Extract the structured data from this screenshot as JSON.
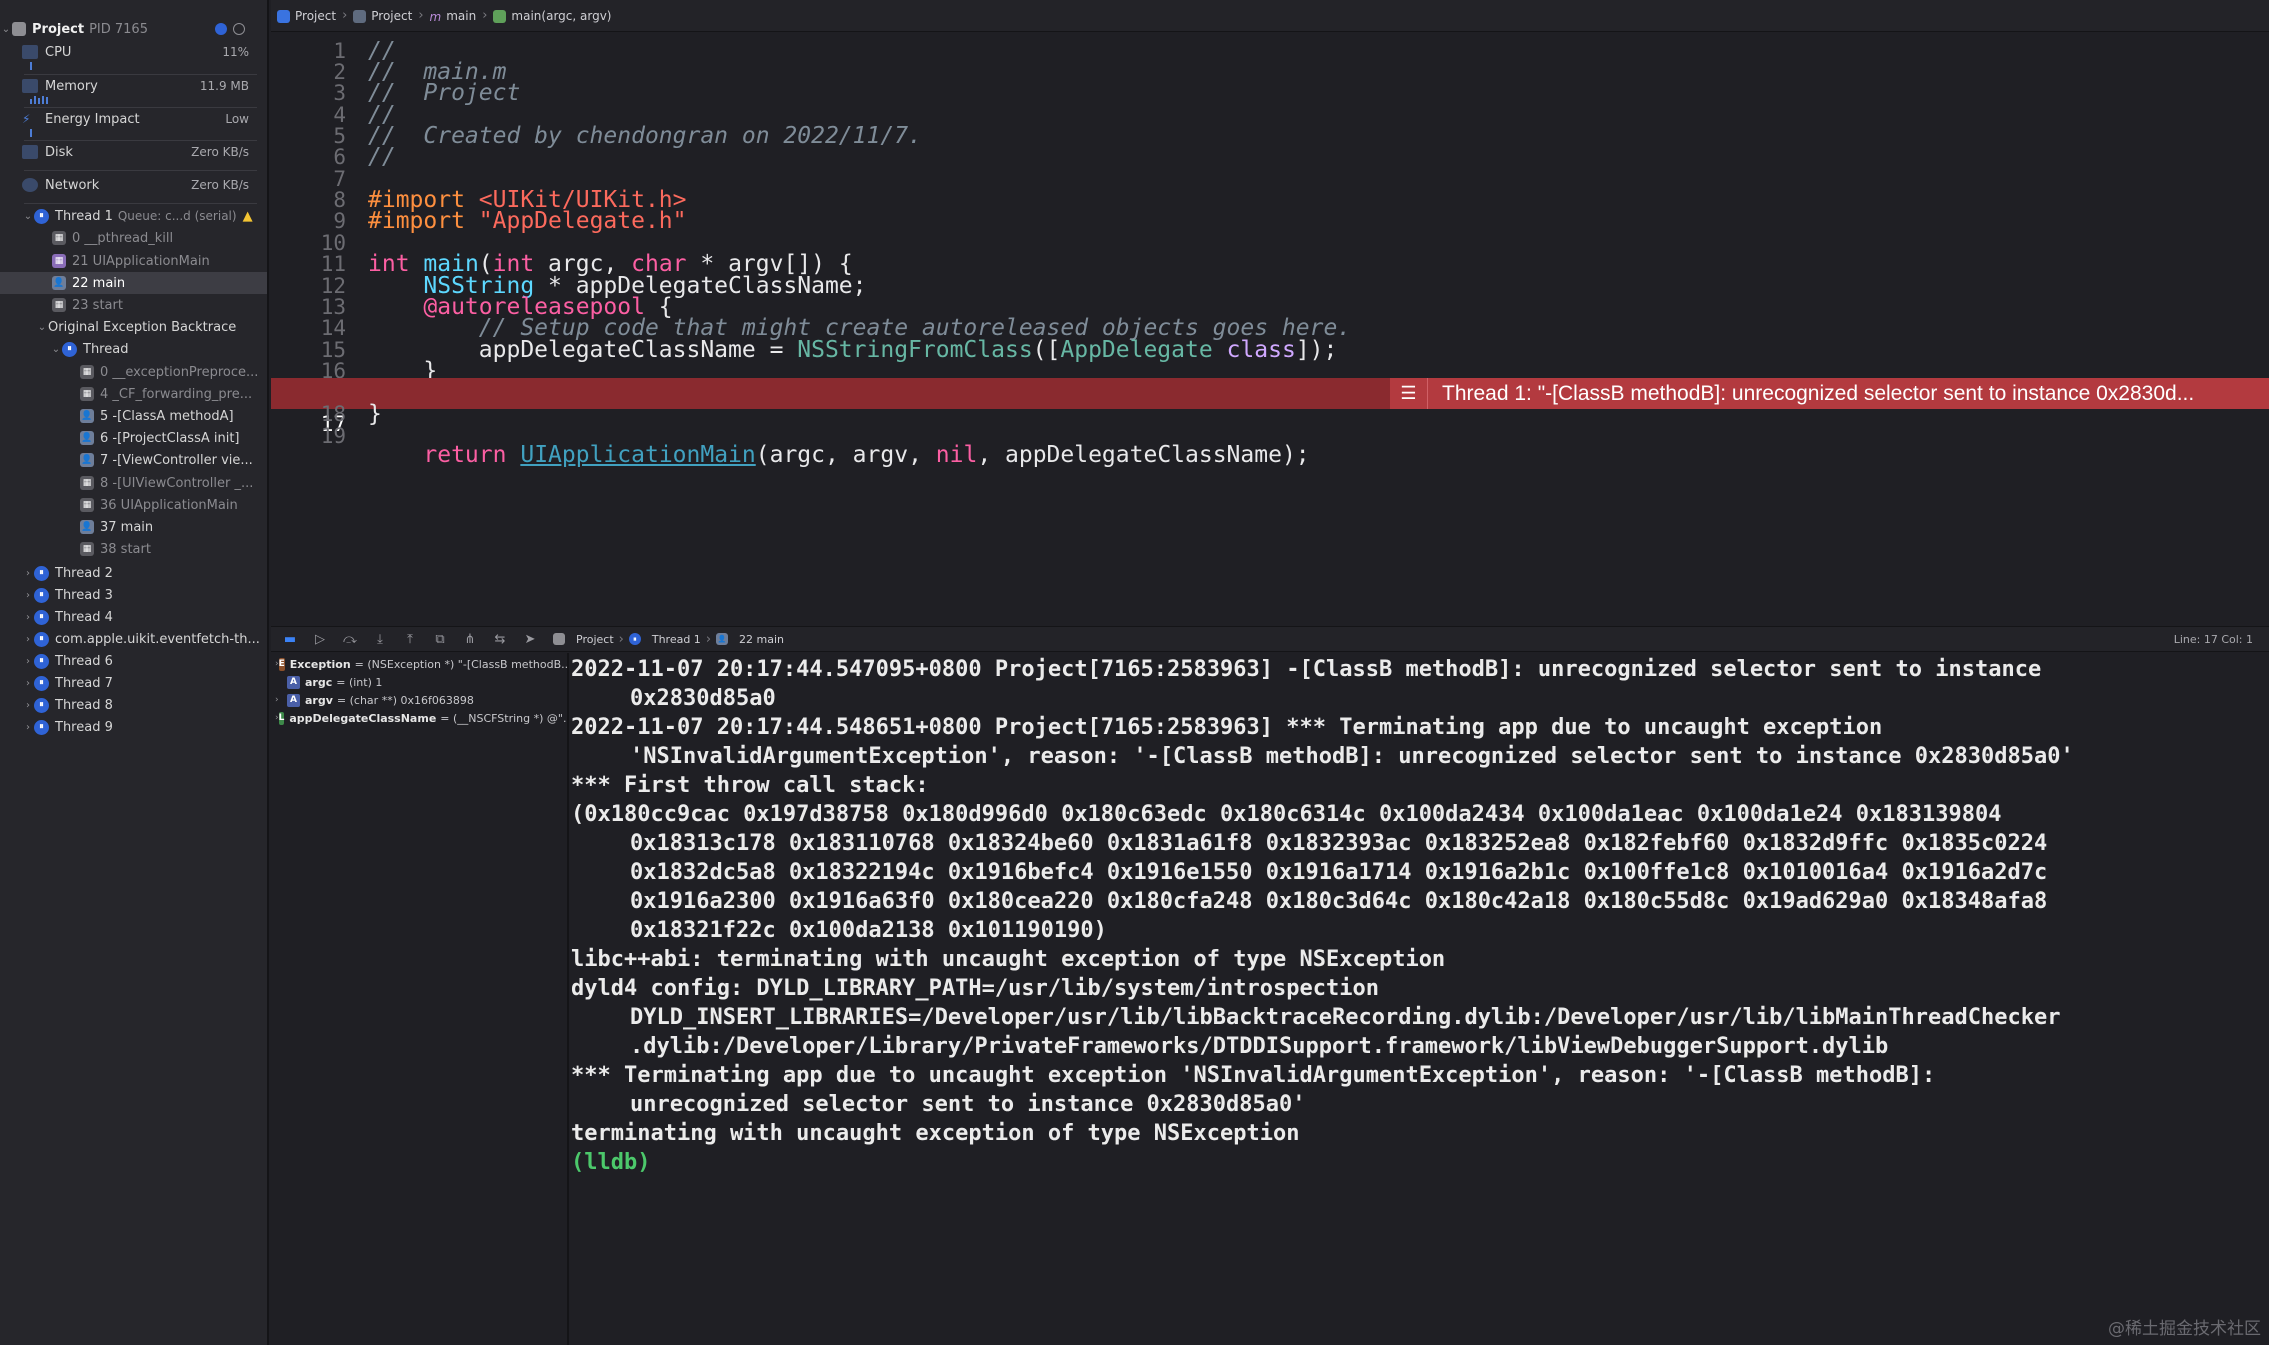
{
  "navigator": {
    "project": {
      "name": "Project",
      "pid": "PID 7165"
    },
    "gauges": [
      {
        "label": "CPU",
        "value": "11%"
      },
      {
        "label": "Memory",
        "value": "11.9 MB"
      },
      {
        "label": "Energy Impact",
        "value": "Low"
      },
      {
        "label": "Disk",
        "value": "Zero KB/s"
      },
      {
        "label": "Network",
        "value": "Zero KB/s"
      }
    ],
    "thread1": {
      "label": "Thread 1",
      "queue": "Queue: c...d (serial)"
    },
    "thread1_frames": [
      "0 __pthread_kill",
      "21 UIApplicationMain",
      "22 main",
      "23 start"
    ],
    "backtrace": {
      "label": "Original Exception Backtrace",
      "thread_label": "Thread"
    },
    "backtrace_frames": [
      "0 __exceptionPreproce...",
      "4 _CF_forwarding_pre...",
      "5 -[ClassA methodA]",
      "6 -[ProjectClassA init]",
      "7 -[ViewController vie...",
      "8 -[UIViewController _...",
      "36 UIApplicationMain",
      "37 main",
      "38 start"
    ],
    "threads": [
      "Thread 2",
      "Thread 3",
      "Thread 4",
      "com.apple.uikit.eventfetch-th...",
      "Thread 6",
      "Thread 7",
      "Thread 8",
      "Thread 9"
    ]
  },
  "jumpbar": {
    "items": [
      "Project",
      "Project",
      "main",
      "main(argc, argv)"
    ]
  },
  "editor": {
    "error_line": 17,
    "error_message": "Thread 1: \"-[ClassB methodB]: unrecognized selector sent to instance 0x2830d..."
  },
  "debugbar": {
    "path": [
      "Project",
      "Thread 1",
      "22 main"
    ],
    "position": "Line: 17  Col: 1"
  },
  "variables": [
    {
      "badge": "Ex",
      "name": "Exception",
      "value": "= (NSException *) \"-[ClassB methodB..."
    },
    {
      "badge": "A",
      "name": "argc",
      "value": "= (int) 1"
    },
    {
      "badge": "A",
      "name": "argv",
      "value": "= (char **) 0x16f063898"
    },
    {
      "badge": "L",
      "name": "appDelegateClassName",
      "value": "= (__NSCFString *) @\"..."
    }
  ],
  "console": {
    "lines": [
      "2022-11-07 20:17:44.547095+0800 Project[7165:2583963] -[ClassB methodB]: unrecognized selector sent to instance",
      "0x2830d85a0",
      "2022-11-07 20:17:44.548651+0800 Project[7165:2583963] *** Terminating app due to uncaught exception",
      "'NSInvalidArgumentException', reason: '-[ClassB methodB]: unrecognized selector sent to instance 0x2830d85a0'",
      "*** First throw call stack:",
      "(0x180cc9cac 0x197d38758 0x180d996d0 0x180c63edc 0x180c6314c 0x100da2434 0x100da1eac 0x100da1e24 0x183139804",
      "0x18313c178 0x183110768 0x18324be60 0x1831a61f8 0x1832393ac 0x183252ea8 0x182febf60 0x1832d9ffc 0x1835c0224",
      "0x1832dc5a8 0x18322194c 0x1916befc4 0x1916e1550 0x1916a1714 0x1916a2b1c 0x100ffe1c8 0x1010016a4 0x1916a2d7c",
      "0x1916a2300 0x1916a63f0 0x180cea220 0x180cfa248 0x180c3d64c 0x180c42a18 0x180c55d8c 0x19ad629a0 0x18348afa8",
      "0x18321f22c 0x100da2138 0x101190190)",
      "libc++abi: terminating with uncaught exception of type NSException",
      "dyld4 config: DYLD_LIBRARY_PATH=/usr/lib/system/introspection",
      "DYLD_INSERT_LIBRARIES=/Developer/usr/lib/libBacktraceRecording.dylib:/Developer/usr/lib/libMainThreadChecker",
      ".dylib:/Developer/Library/PrivateFrameworks/DTDDISupport.framework/libViewDebuggerSupport.dylib",
      "*** Terminating app due to uncaught exception 'NSInvalidArgumentException', reason: '-[ClassB methodB]:",
      "unrecognized selector sent to instance 0x2830d85a0'",
      "terminating with uncaught exception of type NSException"
    ],
    "indented": [
      1,
      3,
      6,
      7,
      8,
      9,
      12,
      13,
      15
    ],
    "prompt": "(lldb)"
  },
  "watermark": "@稀土掘金技术社区",
  "colors": {
    "accent": "#2f63d6",
    "error_line": "#8a2a2f",
    "prompt": "#4cc86b"
  }
}
